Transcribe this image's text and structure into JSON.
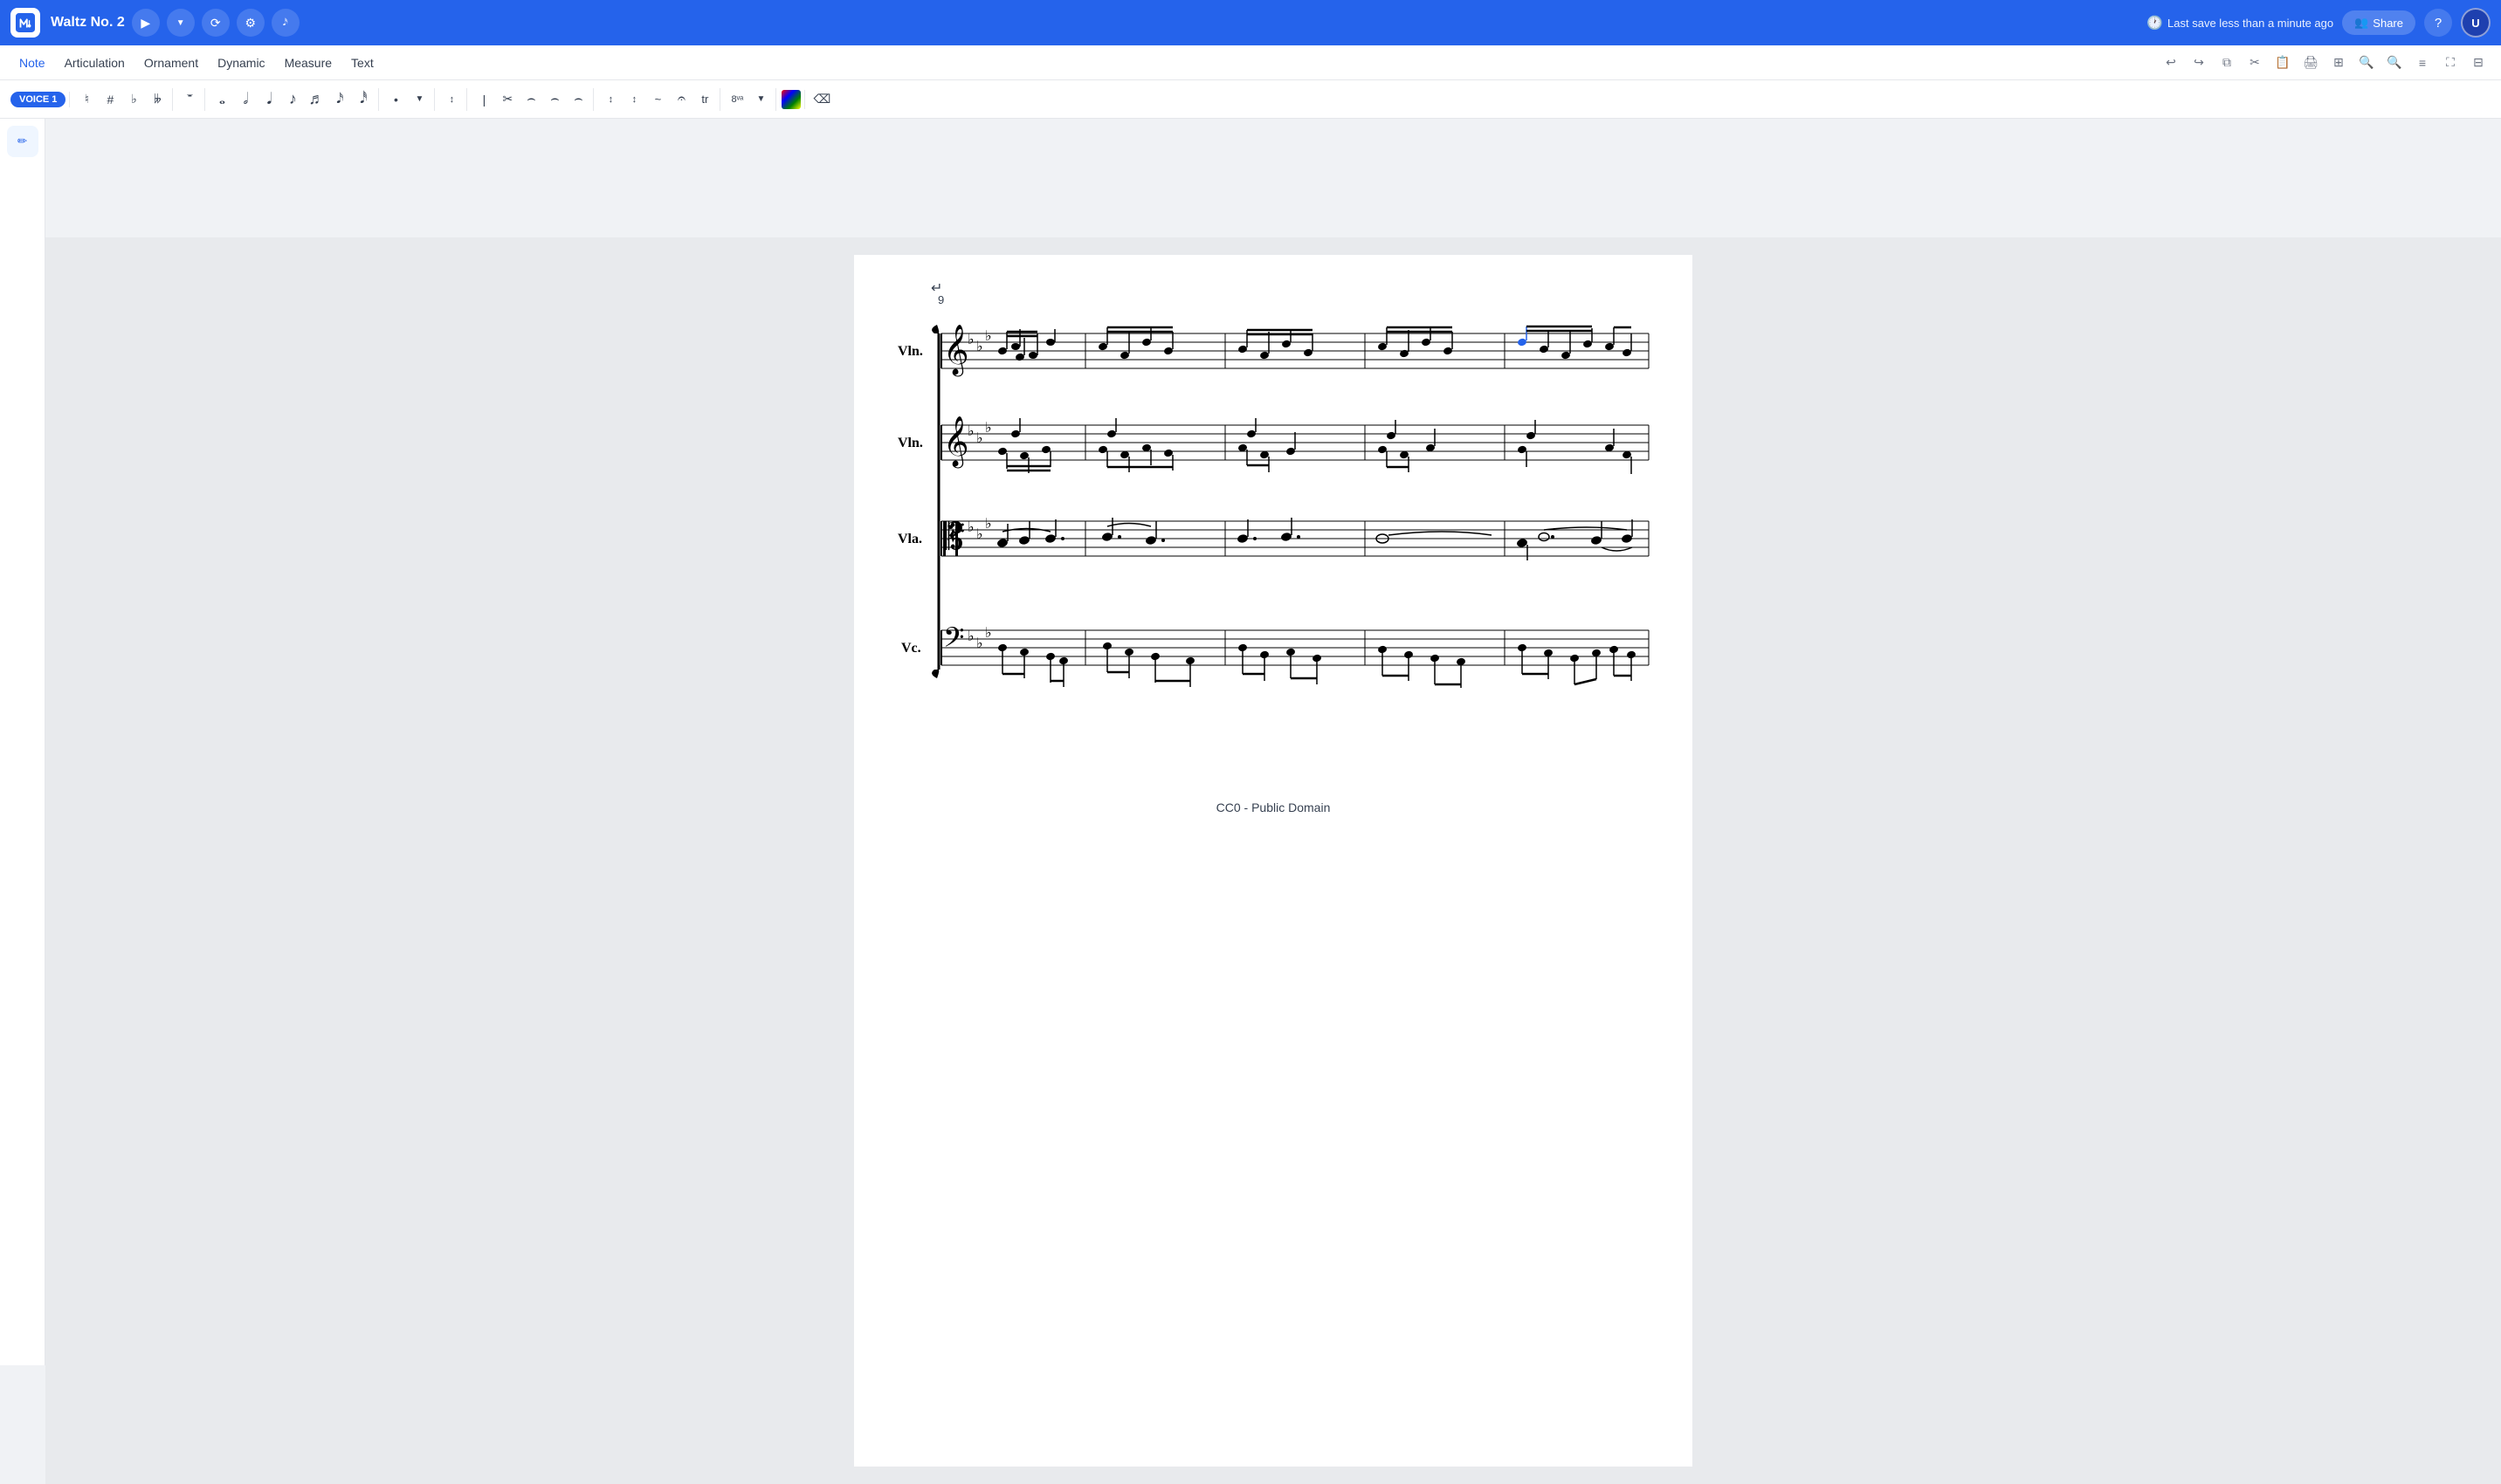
{
  "app": {
    "logo_text": "M",
    "title": "Waltz No. 2"
  },
  "top_bar": {
    "last_save": "Last save less than a minute ago",
    "share_label": "Share"
  },
  "menu": {
    "items": [
      "Note",
      "Articulation",
      "Ornament",
      "Dynamic",
      "Measure",
      "Text"
    ]
  },
  "toolbar": {
    "voice_label": "VOICE 1"
  },
  "score": {
    "measure_number": "9",
    "instruments": [
      "Vln.",
      "Vln.",
      "Vla.",
      "Vc."
    ],
    "footer": "CC0 - Public Domain"
  }
}
